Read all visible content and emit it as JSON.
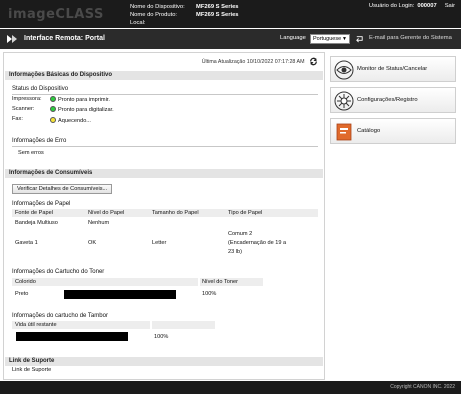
{
  "header": {
    "brand": "imageCLASS",
    "device_name_label": "Nome do Dispositivo:",
    "device_name_value": "MF269 S Series",
    "product_name_label": "Nome do Produto:",
    "product_name_value": "MF269 S Series",
    "location_label": "Local:",
    "login_label": "Usuário do Login:",
    "login_value": "000007",
    "logout": "Sair"
  },
  "nav": {
    "title": "Interface Remota: Portal",
    "language_label": "Language",
    "language_value": "Portuguese",
    "email_link": "E-mail para Gerente do Sistema"
  },
  "main": {
    "last_update": "Última Atualização 10/10/2022 07:17:28 AM",
    "basic_info": {
      "header": "Informações Básicas do Dispositivo",
      "status_title": "Status do Dispositivo",
      "rows": [
        {
          "label": "Impressora:",
          "status": "Pronto para imprimir.",
          "color": "#2ecc40"
        },
        {
          "label": "Scanner:",
          "status": "Pronto para digitalizar.",
          "color": "#2ecc40"
        },
        {
          "label": "Fax:",
          "status": "Aquecendo...",
          "color": "#f5e23a"
        }
      ],
      "error_title": "Informações de Erro",
      "error_value": "Sem erros"
    },
    "consumables": {
      "header": "Informações de Consumíveis",
      "check_button": "Verificar Detalhes de Consumíveis...",
      "paper_title": "Informações de Papel",
      "paper_columns": [
        "Fonte de Papel",
        "Nível do Papel",
        "Tamanho do Papel",
        "Tipo de Papel"
      ],
      "paper_rows": [
        {
          "source": "Bandeja Multiuso",
          "level": "Nenhum",
          "size": "",
          "type_lines": []
        },
        {
          "source": "Gaveta 1",
          "level": "OK",
          "size": "Letter",
          "type_lines": [
            "Comum 2",
            "(Encadernação de 19 a",
            "23 lb)"
          ]
        }
      ],
      "toner_title": "Informações do Cartucho do Toner",
      "toner_columns": [
        "Colorido",
        "Nível do Toner"
      ],
      "toner_rows": [
        {
          "color": "Preto",
          "level": "100%",
          "fill": 1.0
        }
      ],
      "drum_title": "Informações do cartucho de Tambor",
      "drum_columns": [
        "Vida útil restante",
        ""
      ],
      "drum_rows": [
        {
          "level": "100%",
          "fill": 1.0
        }
      ]
    },
    "support": {
      "header": "Link de Suporte",
      "link": "Link de Suporte"
    }
  },
  "sidebar": {
    "items": [
      {
        "label": "Monitor de Status/Cancelar",
        "icon": "eye-icon"
      },
      {
        "label": "Configurações/Registro",
        "icon": "gear-icon"
      },
      {
        "label": "Catálogo",
        "icon": "catalog-icon"
      }
    ]
  },
  "footer": {
    "copyright": "Copyright CANON INC. 2022"
  },
  "colors": {
    "header_bg": "#1b1b1b",
    "section_bg": "#e4e4e4",
    "accent_orange": "#e06a2c"
  }
}
